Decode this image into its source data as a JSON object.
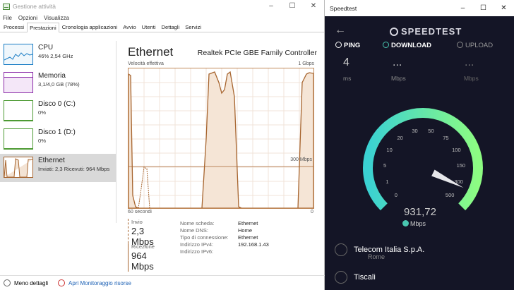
{
  "task_manager": {
    "title": "Gestione attività",
    "menu": [
      "File",
      "Opzioni",
      "Visualizza"
    ],
    "tabs": [
      "Processi",
      "Prestazioni",
      "Cronologia applicazioni",
      "Avvio",
      "Utenti",
      "Dettagli",
      "Servizi"
    ],
    "active_tab": "Prestazioni",
    "sidebar": [
      {
        "name": "CPU",
        "value": "46%  2,54 GHz",
        "color": "#1a7dc5"
      },
      {
        "name": "Memoria",
        "value": "3,1/4,0 GB (78%)",
        "color": "#8a2aa8"
      },
      {
        "name": "Disco 0 (C:)",
        "value": "0%",
        "color": "#4d9a33"
      },
      {
        "name": "Disco 1 (D:)",
        "value": "0%",
        "color": "#4d9a33"
      },
      {
        "name": "Ethernet",
        "value": "Inviati: 2,3 Ricevuti: 964 Mbps",
        "color": "#a7652f"
      }
    ],
    "main": {
      "title": "Ethernet",
      "adapter": "Realtek PCIe GBE Family Controller",
      "graph_label": "Velocità effettiva",
      "graph_max": "1 Gbps",
      "graph_mid": "300 Mbps",
      "graph_left": "60 secondi",
      "graph_right": "0",
      "send_label": "Invio",
      "send_value": "2,3 Mbps",
      "recv_label": "Ricezione",
      "recv_value": "964 Mbps",
      "details": [
        {
          "key": "Nome scheda:",
          "value": "Ethernet"
        },
        {
          "key": "Nome DNS:",
          "value": "Home"
        },
        {
          "key": "Tipo di connessione:",
          "value": "Ethernet"
        },
        {
          "key": "Indirizzo IPv4:",
          "value": "192.168.1.43"
        },
        {
          "key": "Indirizzo IPv6:",
          "value": ""
        }
      ]
    },
    "statusbar": {
      "fewer": "Meno dettagli",
      "monitor": "Apri Monitoraggio risorse"
    }
  },
  "speedtest": {
    "title": "Speedtest",
    "logo": "SPEEDTEST",
    "ping_label": "PING",
    "ping_value": "4",
    "ping_unit": "ms",
    "download_label": "DOWNLOAD",
    "download_value": "...",
    "download_unit": "Mbps",
    "upload_label": "UPLOAD",
    "upload_value": "...",
    "upload_unit": "Mbps",
    "gauge_ticks": [
      "0",
      "1",
      "5",
      "10",
      "20",
      "30",
      "50",
      "75",
      "100",
      "150",
      "300",
      "500"
    ],
    "gauge_fraction": 0.93,
    "result": "931,72",
    "result_unit": "Mbps",
    "isp": "Telecom Italia S.p.A.",
    "isp_location": "Rome",
    "server": "Tiscali",
    "colors": {
      "gauge_start": "#3ad1d2",
      "gauge_end": "#8dfc82",
      "background": "#141526"
    }
  }
}
